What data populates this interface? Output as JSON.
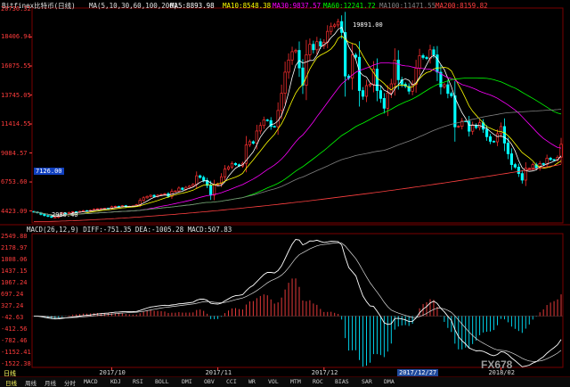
{
  "window": {
    "symbol_header": "Bitfinex比特币(日线)",
    "ma_params": "MA(5,10,30,60,100,200)",
    "ma_values": [
      {
        "label": "MA5:8893.98",
        "color": "#ffffff"
      },
      {
        "label": "MA10:8548.38",
        "color": "#ffff00"
      },
      {
        "label": "MA30:9837.57",
        "color": "#ff00ff"
      },
      {
        "label": "MA60:12241.72",
        "color": "#00ff00"
      },
      {
        "label": "MA100:11471.55",
        "color": "#808080"
      },
      {
        "label": "MA200:8159.82",
        "color": "#ff4040"
      }
    ],
    "macd_header": "MACD(26,12,9) DIFF:-751.35 DEA:-1005.28 MACD:507.83",
    "price_badge": "7126.00",
    "brand": "FX678",
    "bottom_label": "日线",
    "date_box": "2017/12/27"
  },
  "tabs": [
    "日线",
    "周线",
    "月线",
    "分时",
    "MACD",
    "KDJ",
    "RSI",
    "BOLL",
    "DMI",
    "OBV",
    "CCI",
    "WR",
    "VOL",
    "MTM",
    "ROC",
    "BIAS",
    "SAR",
    "DMA"
  ],
  "chart_data": [
    {
      "type": "candlestick",
      "title": "",
      "y_ticks": [
        "20736.32",
        "18406.94",
        "16075.55",
        "13745.05",
        "11414.55",
        "9084.57",
        "6753.60",
        "4423.09"
      ],
      "x_ticks": [
        "2017/10",
        "2017/11",
        "2017/12",
        "2018/02"
      ],
      "ylim": [
        3460,
        20736
      ],
      "annotations": [
        {
          "text": "19891.00",
          "x": 86,
          "y": 19891
        },
        {
          "text": "2980.40",
          "x": 5,
          "y": 3460
        }
      ],
      "colors": {
        "up": "#ff3030",
        "down": "#00ffff"
      },
      "close": [
        4340,
        4270,
        4150,
        4050,
        3980,
        3910,
        3920,
        4090,
        4250,
        4210,
        4300,
        4360,
        4330,
        4390,
        4450,
        4410,
        4480,
        4560,
        4600,
        4610,
        4640,
        4620,
        4760,
        4800,
        4770,
        4840,
        4760,
        4800,
        4830,
        4920,
        5270,
        5480,
        5590,
        5680,
        5580,
        5690,
        5750,
        5810,
        5600,
        5990,
        6030,
        6260,
        6150,
        6320,
        6420,
        6560,
        7250,
        7120,
        6870,
        6470,
        5690,
        6520,
        6620,
        7170,
        7790,
        7960,
        8240,
        8140,
        8040,
        8250,
        9730,
        9990,
        9870,
        10850,
        11290,
        11740,
        11690,
        11220,
        11200,
        12500,
        13880,
        15580,
        16560,
        17230,
        17330,
        15920,
        14530,
        16980,
        17820,
        17380,
        18030,
        17680,
        17990,
        18860,
        19270,
        19380,
        19650,
        18770,
        15270,
        15100,
        16960,
        16780,
        14100,
        13640,
        14500,
        14600,
        15830,
        14100,
        13470,
        12680,
        13910,
        14640,
        16550,
        14970,
        14610,
        14440,
        14050,
        14600,
        15900,
        16910,
        16760,
        16680,
        17380,
        16970,
        15580,
        14400,
        14570,
        13870,
        13680,
        11180,
        11230,
        11650,
        11640,
        10830,
        11320,
        11130,
        11510,
        10990,
        10390,
        10020,
        9980,
        10630,
        11210,
        9880,
        9020,
        8150,
        7950,
        7430,
        6900,
        7860,
        7860,
        8140,
        7870,
        8230,
        8160,
        8670,
        8550,
        8520,
        8740,
        9780
      ]
    },
    {
      "type": "macd",
      "title": "",
      "y_ticks": [
        "2549.88",
        "2178.97",
        "1808.06",
        "1437.15",
        "1067.24",
        "697.24",
        "327.24",
        "-42.63",
        "-412.56",
        "-782.46",
        "-1152.41",
        "-1522.38"
      ],
      "ylim": [
        -1650,
        2650
      ],
      "series": [
        {
          "name": "DIFF",
          "color": "#ffffff"
        },
        {
          "name": "DEA",
          "color": "#ffffff"
        },
        {
          "name": "MACD",
          "color": "#ff4040"
        }
      ]
    }
  ]
}
